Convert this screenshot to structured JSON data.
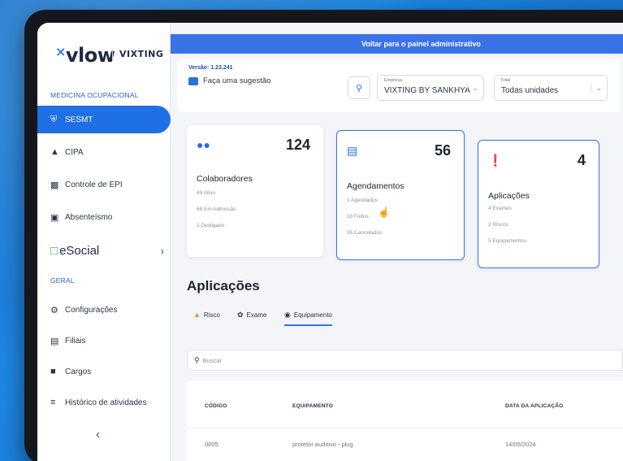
{
  "colors": {
    "accent": "#3a72e8",
    "sidebar_active": "#1f6fe5",
    "risk_icon": "#f08a24"
  },
  "sidebar": {
    "logo_text": "vlow",
    "logo_mark": "×",
    "partner_logo": "VIXTING",
    "section_medicina": "MEDICINA OCUPACIONAL",
    "items_medicina": [
      {
        "label": "SESMT",
        "icon": "shield-icon",
        "active": true
      },
      {
        "label": "CIPA",
        "icon": "hard-hat-icon"
      },
      {
        "label": "Controle de EPI",
        "icon": "factory-icon"
      },
      {
        "label": "Absenteísmo",
        "icon": "document-icon"
      }
    ],
    "esocial_label": "eSocial",
    "section_geral": "GERAL",
    "items_geral": [
      {
        "label": "Configurações",
        "icon": "gear-icon"
      },
      {
        "label": "Filiais",
        "icon": "building-icon"
      },
      {
        "label": "Cargos",
        "icon": "briefcase-icon"
      },
      {
        "label": "Histórico de atividades",
        "icon": "list-icon"
      }
    ],
    "collapse_glyph": "‹"
  },
  "topbar": {
    "label": "Voltar para o painel administrativo"
  },
  "header": {
    "version": "Versão: 1.23.241",
    "suggestion": "Faça uma sugestão",
    "empresa_label": "Empresa",
    "empresa_value": "VIXTING BY SANKHYA",
    "filial_label": "Filial",
    "filial_value": "Todas unidades"
  },
  "cards": [
    {
      "title": "Colaboradores",
      "count": "124",
      "lines": [
        "49 Ativo",
        "68 Em Admissão",
        "1 Desligado"
      ]
    },
    {
      "title": "Agendamentos",
      "count": "56",
      "lines": [
        "1 Agendados",
        "18 Feitos",
        "35 Cancelados"
      ]
    },
    {
      "title": "Aplicações",
      "count": "4",
      "lines": [
        "4 Exames",
        "2 Riscos",
        "5 Equipamentos"
      ]
    }
  ],
  "aplicacoes": {
    "title": "Aplicações",
    "tabs": [
      {
        "label": "Risco",
        "icon": "warning-icon"
      },
      {
        "label": "Exame",
        "icon": "stethoscope-icon"
      },
      {
        "label": "Equipamento",
        "icon": "helmet-icon",
        "selected": true
      }
    ],
    "search_placeholder": "Buscar",
    "table": {
      "headers": [
        "CÓDIGO",
        "EQUIPAMENTO",
        "DATA DA APLICAÇÃO"
      ],
      "rows": [
        [
          "0005",
          "protetor auditivo - plug",
          "14/05/2024"
        ]
      ]
    }
  }
}
